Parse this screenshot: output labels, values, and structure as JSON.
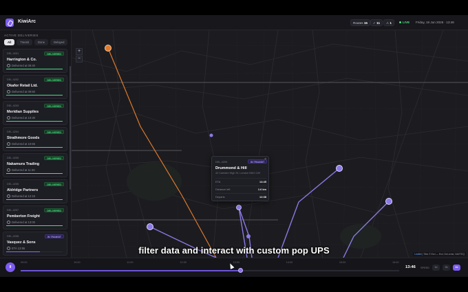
{
  "app": {
    "name": "KiwiArc"
  },
  "header": {
    "routes_label": "Routes",
    "routes_count": "15",
    "delivered_count": "11",
    "drivers_count": "1",
    "live_label": "LIVE",
    "datetime": "Friday, 19 Jun 2026 · 13:46"
  },
  "sidebar": {
    "title": "ACTIVE DELIVERIES",
    "filters": [
      "All",
      "Transit",
      "Done",
      "Delayed"
    ],
    "cards": [
      {
        "id": "DEL-4201",
        "status": "DELIVERED",
        "name": "Harrington & Co.",
        "time": "Delivered at 09:40",
        "progress": 1.0
      },
      {
        "id": "DEL-4202",
        "status": "DELIVERED",
        "name": "Okafor Retail Ltd.",
        "time": "Delivered at 09:50",
        "progress": 1.0
      },
      {
        "id": "DEL-4203",
        "status": "DELIVERED",
        "name": "Meridian Supplies",
        "time": "Delivered at 10:30",
        "progress": 1.0
      },
      {
        "id": "DEL-4204",
        "status": "DELIVERED",
        "name": "Strathmore Goods",
        "time": "Delivered at 10:55",
        "progress": 1.0
      },
      {
        "id": "DEL-4205",
        "status": "DELIVERED",
        "name": "Nakamura Trading",
        "time": "Delivered at 11:30",
        "progress": 1.0
      },
      {
        "id": "DEL-4206",
        "status": "DELIVERED",
        "name": "Aldridge Partners",
        "time": "Delivered at 12:15",
        "progress": 1.0
      },
      {
        "id": "DEL-4207",
        "status": "DELIVERED",
        "name": "Pemberton Freight",
        "time": "Delivered at 13:00",
        "progress": 1.0
      },
      {
        "id": "DEL-4208",
        "status": "IN TRANSIT",
        "name": "Vasquez & Sons",
        "time": "ETA 13:55",
        "progress": 0.6
      }
    ]
  },
  "map": {
    "zoom_in": "+",
    "zoom_out": "−",
    "attribution_link": "Leaflet",
    "attribution_text": " | Tiles © Esri — Esri, DeLorme, NAVTEQ"
  },
  "popup": {
    "id": "DEL-4209",
    "status": "IN TRANSIT",
    "close": "×",
    "name": "Drummond & Hill",
    "address": "42 Camden High St, London NW1 0JH",
    "rows": [
      {
        "label": "ETA",
        "value": "14:45"
      },
      {
        "label": "Distance left",
        "value": "1.6 km"
      },
      {
        "label": "Departs",
        "value": "12:38"
      }
    ]
  },
  "caption": "filter data and interact with custom pop UPS",
  "timeline": {
    "play_label": "II",
    "ticks": [
      "09:00",
      "10:00",
      "11:00",
      "12:00",
      "13:00",
      "14:00",
      "15:00",
      "16:00"
    ],
    "progress": 0.58,
    "current_time": "13:46",
    "speed_label": "SPEED",
    "speeds": [
      "1x",
      "2x",
      "4x"
    ],
    "active_speed": "4x"
  },
  "colors": {
    "accent": "#7c5cf0",
    "delivered": "#4ade80",
    "route_orange": "#e07a2c"
  }
}
